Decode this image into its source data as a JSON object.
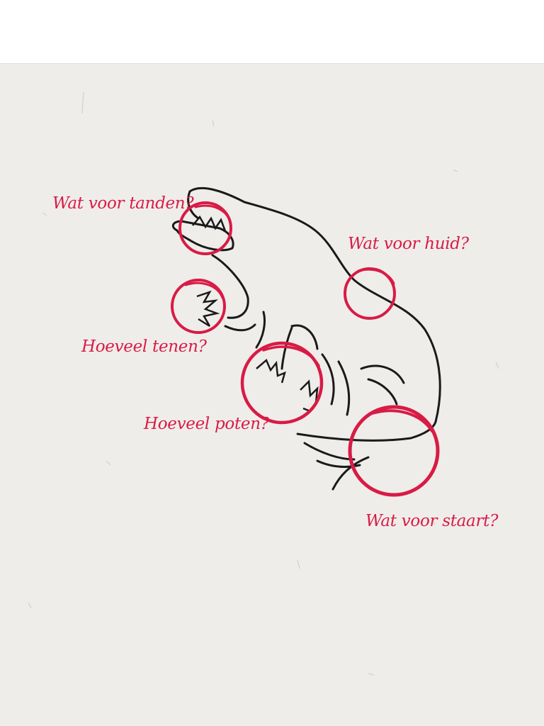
{
  "labels": {
    "teeth": "Wat voor tanden?",
    "skin": "Wat voor huid?",
    "toes": "Hoeveel tenen?",
    "legs": "Hoeveel poten?",
    "tail": "Wat voor staart?"
  },
  "colors": {
    "accent": "#d81b45",
    "ink": "#1a1a1a",
    "paper": "#efedea",
    "background": "#ffffff"
  }
}
